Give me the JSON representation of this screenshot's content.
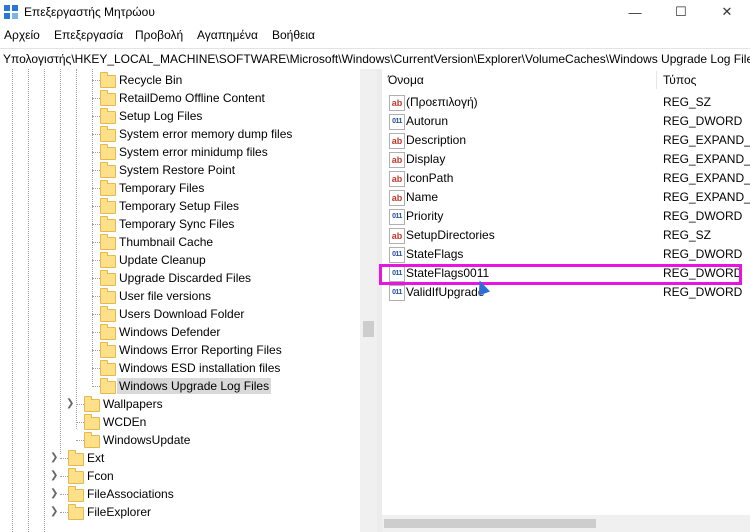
{
  "window": {
    "title": "Επεξεργαστής Μητρώου"
  },
  "menu": {
    "items": [
      "Αρχείο",
      "Επεξεργασία",
      "Προβολή",
      "Αγαπημένα",
      "Βοήθεια"
    ]
  },
  "address": {
    "path": "Υπολογιστής\\HKEY_LOCAL_MACHINE\\SOFTWARE\\Microsoft\\Windows\\CurrentVersion\\Explorer\\VolumeCaches\\Windows Upgrade Log Files"
  },
  "tree": {
    "items": [
      {
        "label": "Recycle Bin"
      },
      {
        "label": "RetailDemo Offline Content"
      },
      {
        "label": "Setup Log Files"
      },
      {
        "label": "System error memory dump files"
      },
      {
        "label": "System error minidump files"
      },
      {
        "label": "System Restore Point"
      },
      {
        "label": "Temporary Files"
      },
      {
        "label": "Temporary Setup Files"
      },
      {
        "label": "Temporary Sync Files"
      },
      {
        "label": "Thumbnail Cache"
      },
      {
        "label": "Update Cleanup"
      },
      {
        "label": "Upgrade Discarded Files"
      },
      {
        "label": "User file versions"
      },
      {
        "label": "Users Download Folder"
      },
      {
        "label": "Windows Defender"
      },
      {
        "label": "Windows Error Reporting Files"
      },
      {
        "label": "Windows ESD installation files"
      },
      {
        "label": "Windows Upgrade Log Files"
      },
      {
        "label": "Wallpapers"
      },
      {
        "label": "WCDEn"
      },
      {
        "label": "WindowsUpdate"
      },
      {
        "label": "Ext"
      },
      {
        "label": "Fcon"
      },
      {
        "label": "FileAssociations"
      },
      {
        "label": "FileExplorer"
      }
    ]
  },
  "list": {
    "headers": {
      "name": "Όνομα",
      "type": "Τύπος"
    },
    "rows": [
      {
        "name": "(Προεπιλογή)",
        "type": "REG_SZ",
        "icon": "string-value-icon"
      },
      {
        "name": "Autorun",
        "type": "REG_DWORD",
        "icon": "binary-value-icon"
      },
      {
        "name": "Description",
        "type": "REG_EXPAND_SZ",
        "icon": "string-value-icon"
      },
      {
        "name": "Display",
        "type": "REG_EXPAND_SZ",
        "icon": "string-value-icon"
      },
      {
        "name": "IconPath",
        "type": "REG_EXPAND_SZ",
        "icon": "string-value-icon"
      },
      {
        "name": "Name",
        "type": "REG_EXPAND_SZ",
        "icon": "string-value-icon"
      },
      {
        "name": "Priority",
        "type": "REG_DWORD",
        "icon": "binary-value-icon"
      },
      {
        "name": "SetupDirectories",
        "type": "REG_SZ",
        "icon": "string-value-icon"
      },
      {
        "name": "StateFlags",
        "type": "REG_DWORD",
        "icon": "binary-value-icon"
      },
      {
        "name": "StateFlags0011",
        "type": "REG_DWORD",
        "icon": "binary-value-icon"
      },
      {
        "name": "ValidIfUpgrade",
        "type": "REG_DWORD",
        "icon": "binary-value-icon"
      }
    ]
  },
  "icon_glyphs": {
    "string": "ab",
    "binary": "011"
  },
  "colors": {
    "highlight": "#e815e0",
    "selection": "#d9d9d9",
    "folder": "#ffe08a"
  }
}
